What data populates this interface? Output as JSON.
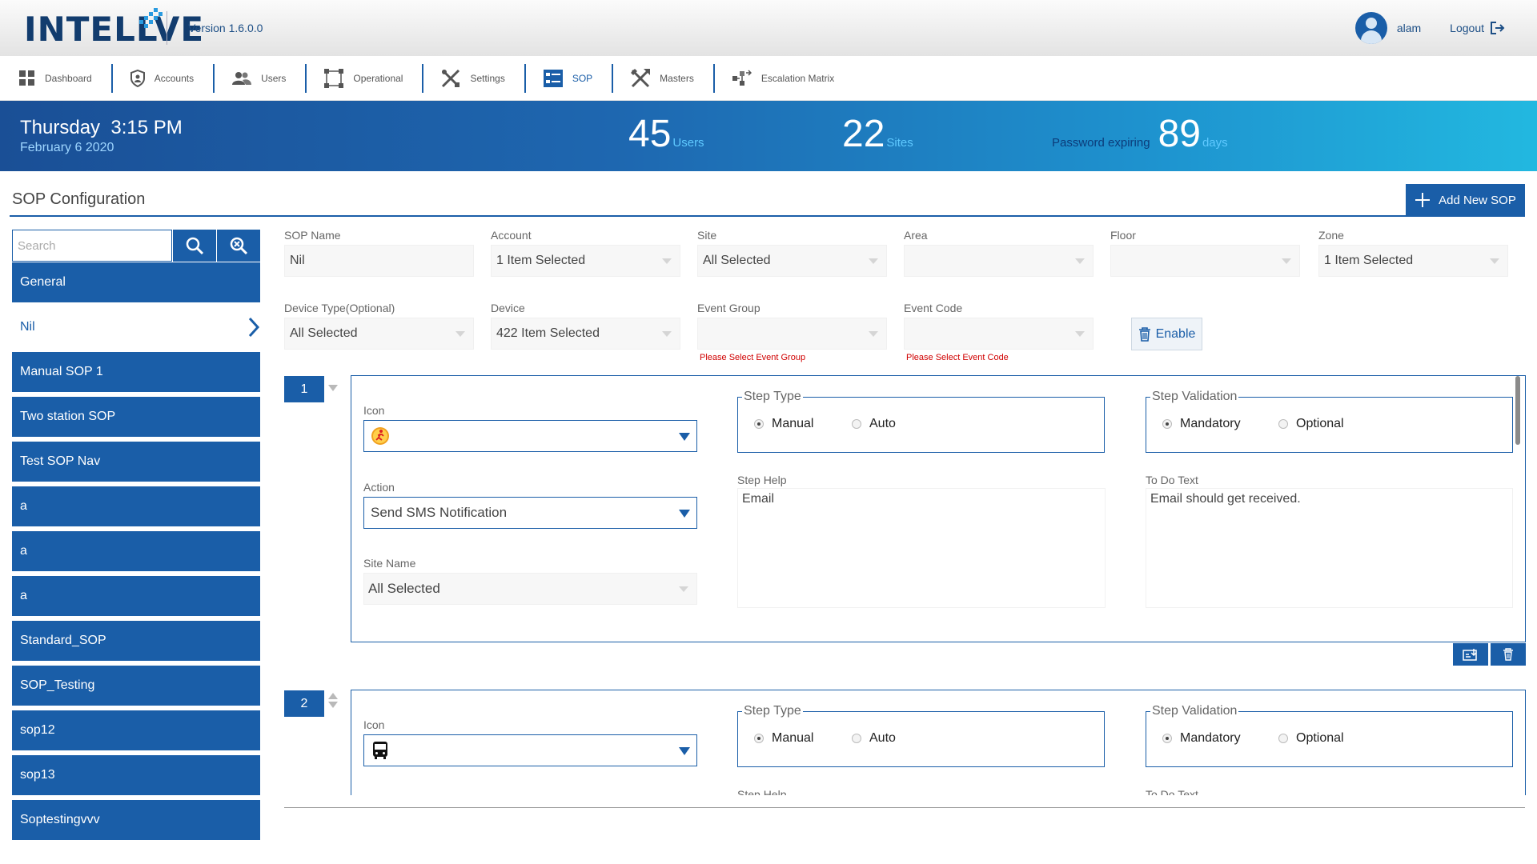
{
  "header": {
    "logo_text": "INTELLVE",
    "version": "Version 1.6.0.0",
    "username": "alam",
    "logout_label": "Logout"
  },
  "nav": [
    {
      "label": "Dashboard",
      "icon": "dashboard-icon"
    },
    {
      "label": "Accounts",
      "icon": "shield-user-icon"
    },
    {
      "label": "Users",
      "icon": "users-icon"
    },
    {
      "label": "Operational",
      "icon": "operational-icon"
    },
    {
      "label": "Settings",
      "icon": "tools-icon"
    },
    {
      "label": "SOP",
      "icon": "sop-icon"
    },
    {
      "label": "Masters",
      "icon": "masters-icon"
    },
    {
      "label": "Escalation Matrix",
      "icon": "escalation-icon"
    }
  ],
  "banner": {
    "day_time": "Thursday  3:15 PM",
    "date": "February 6 2020",
    "users_count": "45",
    "users_label": "Users",
    "sites_count": "22",
    "sites_label": "Sites",
    "password_prefix": "Password expiring",
    "password_days": "89",
    "days_label": "days"
  },
  "page": {
    "title": "SOP Configuration",
    "add_button": "Add New SOP",
    "search_placeholder": "Search"
  },
  "sop_list": {
    "general": "General",
    "selected": "Nil",
    "items": [
      "Manual SOP 1",
      "Two station SOP",
      "Test SOP Nav",
      "a",
      "a",
      "a",
      "Standard_SOP",
      "SOP_Testing",
      "sop12",
      "sop13",
      "Soptestingvvv"
    ]
  },
  "form": {
    "sop_name": {
      "label": "SOP Name",
      "value": "Nil"
    },
    "account": {
      "label": "Account",
      "value": "1 Item Selected"
    },
    "site": {
      "label": "Site",
      "value": "All Selected"
    },
    "area": {
      "label": "Area",
      "value": ""
    },
    "floor": {
      "label": "Floor",
      "value": ""
    },
    "zone": {
      "label": "Zone",
      "value": "1 Item Selected"
    },
    "device_type": {
      "label": "Device Type(Optional)",
      "value": "All Selected"
    },
    "device": {
      "label": "Device",
      "value": "422 Item Selected"
    },
    "event_group": {
      "label": "Event Group",
      "value": "",
      "error": "Please Select Event Group"
    },
    "event_code": {
      "label": "Event Code",
      "value": "",
      "error": "Please Select Event Code"
    },
    "enable_button": "Enable"
  },
  "steps": [
    {
      "number": "1",
      "icon_label": "Icon",
      "icon_value": "person-running-icon",
      "action_label": "Action",
      "action_value": "Send SMS Notification",
      "site_name_label": "Site Name",
      "site_name_value": "All Selected",
      "step_type_label": "Step Type",
      "step_type_options": [
        "Manual",
        "Auto"
      ],
      "step_type_selected": "Manual",
      "step_validation_label": "Step Validation",
      "step_validation_options": [
        "Mandatory",
        "Optional"
      ],
      "step_validation_selected": "Mandatory",
      "step_help_label": "Step Help",
      "step_help_value": "Email",
      "todo_label": "To Do Text",
      "todo_value": "Email should get received."
    },
    {
      "number": "2",
      "icon_label": "Icon",
      "icon_value": "bus-icon",
      "step_type_label": "Step Type",
      "step_type_options": [
        "Manual",
        "Auto"
      ],
      "step_type_selected": "Manual",
      "step_validation_label": "Step Validation",
      "step_validation_options": [
        "Mandatory",
        "Optional"
      ],
      "step_validation_selected": "Mandatory",
      "step_help_label": "Step Help",
      "todo_label": "To Do Text"
    }
  ],
  "colors": {
    "primary": "#1a5ea8",
    "error": "#d00000",
    "banner_start": "#1a4f96",
    "banner_end": "#22b8e0"
  }
}
